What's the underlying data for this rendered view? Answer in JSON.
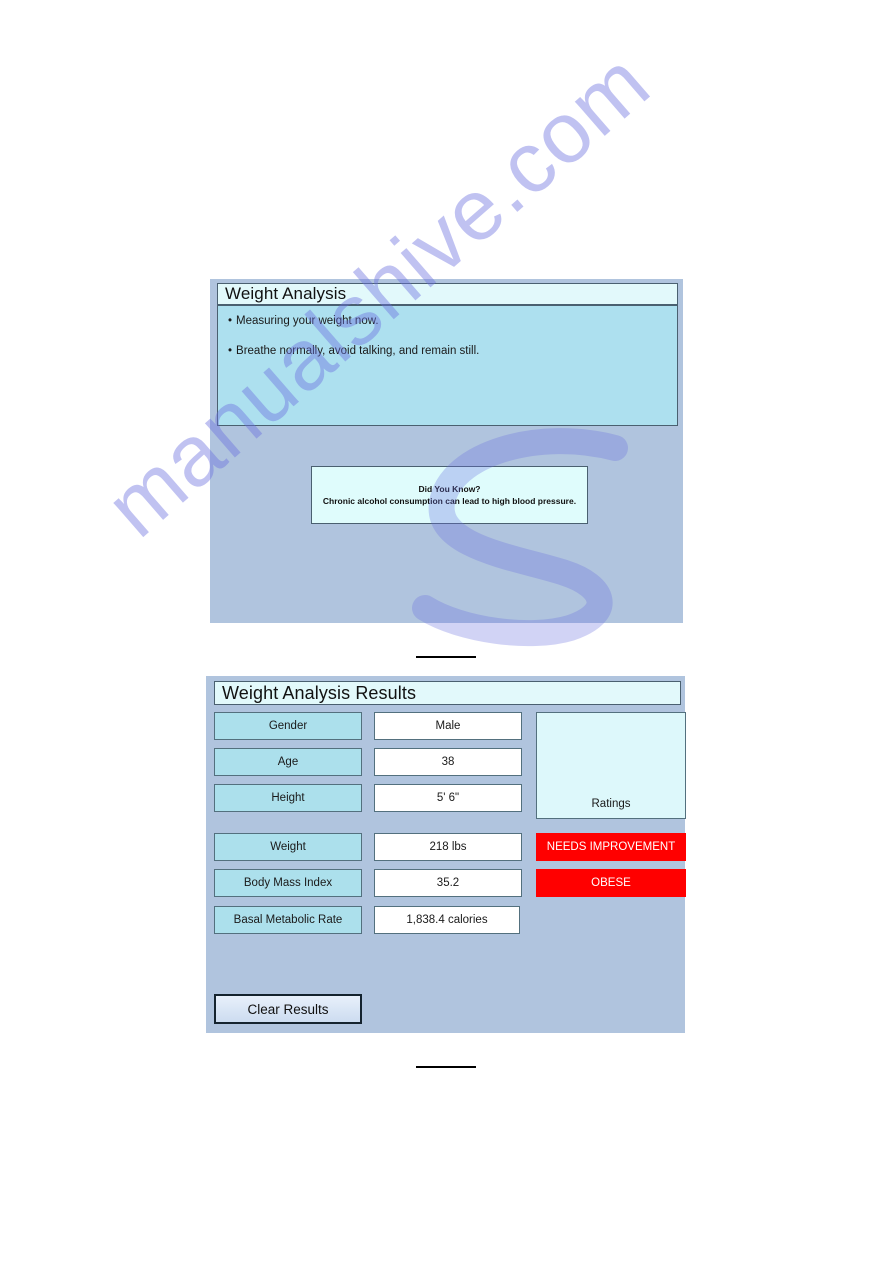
{
  "screens": {
    "analysis": {
      "header_title": "Weight Analysis",
      "bullets": [
        "Measuring your weight now.",
        "Breathe normally, avoid talking, and remain still."
      ],
      "did_you_know": {
        "title": "Did You Know?",
        "body": "Chronic alcohol consumption can lead to high blood pressure."
      }
    },
    "results": {
      "header_title": "Weight Analysis Results",
      "ratings_label": "Ratings",
      "rows": [
        {
          "label": "Gender",
          "value": "Male",
          "badge": ""
        },
        {
          "label": "Age",
          "value": "38",
          "badge": ""
        },
        {
          "label": "Height",
          "value": "5' 6\"",
          "badge": ""
        },
        {
          "label": "Weight",
          "value": "218 lbs",
          "badge": "NEEDS IMPROVEMENT"
        },
        {
          "label": "Body Mass Index",
          "value": "35.2",
          "badge": "OBESE"
        },
        {
          "label": "Basal Metabolic Rate",
          "value": "1,838.4 calories",
          "badge": ""
        }
      ],
      "clear_button_label": "Clear Results"
    }
  },
  "watermark": {
    "text": "manualshive.com"
  },
  "colors": {
    "panel_background": "#b0c4de",
    "header_background": "#e2f9fb",
    "info_box_background": "#ade0ef",
    "label_cell_background": "#ace0ec",
    "value_cell_background": "#ffffff",
    "ratings_background": "#ddf8fb",
    "badge_red": "#ff0000",
    "border": "#53707e"
  }
}
